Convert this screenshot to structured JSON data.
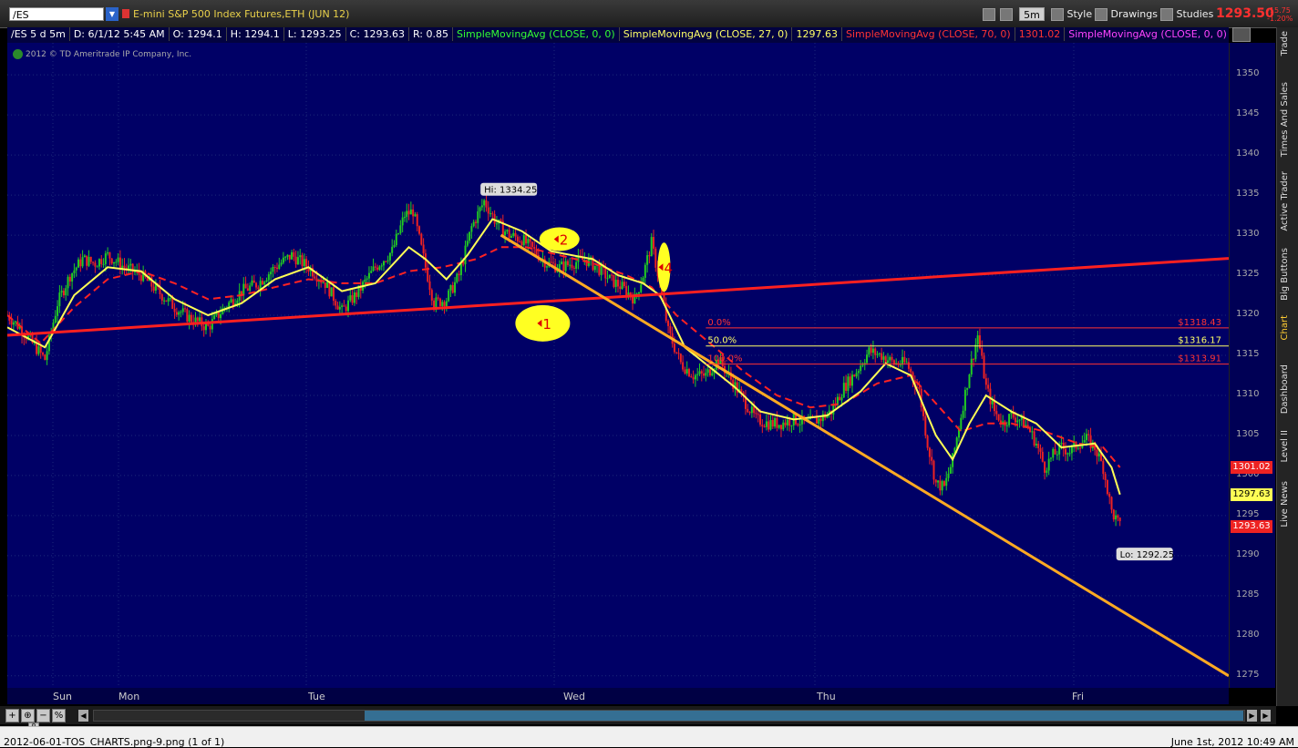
{
  "toolbar": {
    "symbol": "/ES",
    "instrument": "E-mini S&P 500 Index Futures,ETH (JUN 12)",
    "period": "5m",
    "style_label": "Style",
    "drawings_label": "Drawings",
    "studies_label": "Studies",
    "last_price": "1293.50",
    "change": "-15.75",
    "change_pct": "-1.20%"
  },
  "study_bar": {
    "items": [
      {
        "text": "/ES 5 d 5m",
        "color": "#ffffff"
      },
      {
        "text": "D: 6/1/12 5:45 AM",
        "color": "#ffffff"
      },
      {
        "text": "O: 1294.1",
        "color": "#ffffff"
      },
      {
        "text": "H: 1294.1",
        "color": "#ffffff"
      },
      {
        "text": "L: 1293.25",
        "color": "#ffffff"
      },
      {
        "text": "C: 1293.63",
        "color": "#ffffff"
      },
      {
        "text": "R: 0.85",
        "color": "#ffffff"
      },
      {
        "text": "SimpleMovingAvg (CLOSE, 0, 0)",
        "color": "#33ff33"
      },
      {
        "text": "SimpleMovingAvg (CLOSE, 27, 0)",
        "color": "#ffff66"
      },
      {
        "text": "1297.63",
        "color": "#ffff66"
      },
      {
        "text": "SimpleMovingAvg (CLOSE, 70, 0)",
        "color": "#ff3333"
      },
      {
        "text": "1301.02",
        "color": "#ff3333"
      },
      {
        "text": "SimpleMovingAvg (CLOSE, 0, 0)",
        "color": "#ff44ff"
      }
    ]
  },
  "credit": "2012 © TD Ameritrade IP Company, Inc.",
  "side_tabs": [
    "Trade",
    "Times And Sales",
    "Active Trader",
    "Big Buttons",
    "Chart",
    "Dashboard",
    "Level II",
    "Live News"
  ],
  "status": {
    "filename": "2012-06-01-TOS_CHARTS.png-9.png (1 of 1)",
    "datetime": "June 1st, 2012 10:49 AM"
  },
  "chart_data": {
    "type": "candlestick",
    "y_range": [
      1273.5,
      1354
    ],
    "y_ticks": [
      1350,
      1345,
      1340,
      1335,
      1330,
      1325,
      1320,
      1315,
      1310,
      1305,
      1300,
      1295,
      1290,
      1285,
      1280,
      1275
    ],
    "x_labels": [
      "Sun",
      "Mon",
      "Tue",
      "Wed",
      "Thu",
      "Fri"
    ],
    "colors": {
      "up": "#22cc22",
      "down": "#ee2222",
      "sma27": "#ffff55",
      "sma70": "#ff2222",
      "background": "#000066"
    },
    "price_path": [
      [
        0,
        1320
      ],
      [
        1.5,
        1318.5
      ],
      [
        3,
        1316.5
      ],
      [
        4.5,
        1314.5
      ],
      [
        6,
        1321.5
      ],
      [
        7.5,
        1325
      ],
      [
        9,
        1327
      ],
      [
        10.5,
        1326.5
      ],
      [
        12,
        1327.5
      ],
      [
        14,
        1326
      ],
      [
        16,
        1325
      ],
      [
        18,
        1323
      ],
      [
        20,
        1321
      ],
      [
        22,
        1319.5
      ],
      [
        24,
        1318.5
      ],
      [
        26,
        1321
      ],
      [
        28,
        1323
      ],
      [
        30,
        1324
      ],
      [
        32,
        1326
      ],
      [
        34,
        1327.5
      ],
      [
        36,
        1326
      ],
      [
        38,
        1324
      ],
      [
        40,
        1320.5
      ],
      [
        42,
        1323
      ],
      [
        44,
        1326
      ],
      [
        46,
        1328
      ],
      [
        47.5,
        1332.5
      ],
      [
        48.5,
        1333
      ],
      [
        50,
        1326
      ],
      [
        51,
        1321.5
      ],
      [
        52.5,
        1322
      ],
      [
        54,
        1325
      ],
      [
        55.5,
        1331
      ],
      [
        57,
        1334.25
      ],
      [
        58.5,
        1331.5
      ],
      [
        60,
        1330
      ],
      [
        61.5,
        1329.5
      ],
      [
        63,
        1328
      ],
      [
        64.5,
        1326.5
      ],
      [
        66,
        1326
      ],
      [
        67.5,
        1326.5
      ],
      [
        69,
        1327
      ],
      [
        70.5,
        1326
      ],
      [
        72,
        1324.5
      ],
      [
        73.5,
        1323.5
      ],
      [
        75,
        1322
      ],
      [
        76,
        1325
      ],
      [
        77,
        1329
      ],
      [
        78,
        1324
      ],
      [
        79,
        1318
      ],
      [
        80.5,
        1314
      ],
      [
        82,
        1312.5
      ],
      [
        83.5,
        1312.5
      ],
      [
        85,
        1314.5
      ],
      [
        86.5,
        1312
      ],
      [
        88,
        1309.5
      ],
      [
        89.5,
        1307
      ],
      [
        91,
        1306.5
      ],
      [
        92.5,
        1306.5
      ],
      [
        94,
        1307
      ],
      [
        95.5,
        1306.5
      ],
      [
        97,
        1307
      ],
      [
        98.5,
        1308
      ],
      [
        100,
        1311
      ],
      [
        101.5,
        1313
      ],
      [
        103,
        1315.5
      ],
      [
        104.5,
        1315
      ],
      [
        106,
        1314
      ],
      [
        107.5,
        1314
      ],
      [
        109,
        1310.5
      ],
      [
        110,
        1304
      ],
      [
        111,
        1299
      ],
      [
        112,
        1298.5
      ],
      [
        113,
        1302
      ],
      [
        114,
        1307.5
      ],
      [
        115,
        1313
      ],
      [
        116,
        1317.5
      ],
      [
        117,
        1311
      ],
      [
        118,
        1308
      ],
      [
        119,
        1306.5
      ],
      [
        120,
        1307.5
      ],
      [
        121,
        1307
      ],
      [
        122,
        1306
      ],
      [
        123,
        1304
      ],
      [
        124,
        1301
      ],
      [
        125,
        1302.5
      ],
      [
        126,
        1303.5
      ],
      [
        127,
        1303
      ],
      [
        128,
        1304
      ],
      [
        129,
        1304.5
      ],
      [
        130,
        1303.5
      ],
      [
        131,
        1301
      ],
      [
        132,
        1295.5
      ],
      [
        133,
        1293.63
      ]
    ],
    "sma27_path": [
      [
        0,
        1318.5
      ],
      [
        4.5,
        1316
      ],
      [
        8,
        1322.5
      ],
      [
        12,
        1326
      ],
      [
        16,
        1325.5
      ],
      [
        20,
        1322
      ],
      [
        24,
        1320
      ],
      [
        28,
        1321.5
      ],
      [
        32,
        1324.5
      ],
      [
        36,
        1326
      ],
      [
        40,
        1323
      ],
      [
        44,
        1324
      ],
      [
        48,
        1328.5
      ],
      [
        50,
        1327
      ],
      [
        52.5,
        1324.5
      ],
      [
        55,
        1327.5
      ],
      [
        58,
        1332
      ],
      [
        61.5,
        1330.5
      ],
      [
        65,
        1328
      ],
      [
        70,
        1327
      ],
      [
        73,
        1325
      ],
      [
        76,
        1324
      ],
      [
        78,
        1322.5
      ],
      [
        81,
        1316
      ],
      [
        84,
        1313.5
      ],
      [
        87,
        1311
      ],
      [
        90,
        1308
      ],
      [
        94,
        1307
      ],
      [
        98,
        1307.5
      ],
      [
        102,
        1310.5
      ],
      [
        105,
        1314
      ],
      [
        108,
        1312.5
      ],
      [
        111,
        1305
      ],
      [
        113,
        1302
      ],
      [
        115,
        1306.5
      ],
      [
        117,
        1310
      ],
      [
        120,
        1308
      ],
      [
        123,
        1306.5
      ],
      [
        126,
        1303.5
      ],
      [
        130,
        1304
      ],
      [
        132,
        1301
      ],
      [
        133,
        1297.63
      ]
    ],
    "sma70_path": [
      [
        0,
        1320
      ],
      [
        4,
        1316.5
      ],
      [
        8,
        1321
      ],
      [
        12,
        1324.5
      ],
      [
        16,
        1325.5
      ],
      [
        20,
        1324
      ],
      [
        24,
        1322
      ],
      [
        28,
        1322.5
      ],
      [
        32,
        1323.5
      ],
      [
        36,
        1324.5
      ],
      [
        40,
        1324
      ],
      [
        44,
        1324
      ],
      [
        48,
        1325.5
      ],
      [
        52,
        1326
      ],
      [
        56,
        1327
      ],
      [
        59,
        1328.5
      ],
      [
        62,
        1328.5
      ],
      [
        66,
        1327.5
      ],
      [
        70,
        1326.5
      ],
      [
        74,
        1325
      ],
      [
        77,
        1323.5
      ],
      [
        80,
        1320
      ],
      [
        84,
        1316.5
      ],
      [
        88,
        1313
      ],
      [
        92,
        1310
      ],
      [
        96,
        1308.5
      ],
      [
        100,
        1309
      ],
      [
        104,
        1311.5
      ],
      [
        108,
        1312.5
      ],
      [
        111,
        1309
      ],
      [
        114,
        1305.5
      ],
      [
        117,
        1306.5
      ],
      [
        120,
        1306.5
      ],
      [
        124,
        1305.5
      ],
      [
        128,
        1304
      ],
      [
        131,
        1303.5
      ],
      [
        133,
        1301.02
      ]
    ],
    "annotations": {
      "hi": {
        "text": "Hi: 1334.25",
        "x": 57,
        "y": 1334.25
      },
      "lo": {
        "text": "Lo: 1292.25",
        "x": 133,
        "y": 1292.25
      },
      "fib_levels": [
        {
          "pct": "0.0%",
          "price": 1318.43,
          "label": "$1318.43",
          "color": "#ff3333"
        },
        {
          "pct": "50.0%",
          "price": 1316.17,
          "label": "$1316.17",
          "color": "#ffff66"
        },
        {
          "pct": "100.0%",
          "price": 1313.91,
          "label": "$1313.91",
          "color": "#ff3333"
        }
      ],
      "trendlines": [
        {
          "name": "support-trendline",
          "color": "#ff2020",
          "from": [
            0,
            1317.5
          ],
          "to": [
            146,
            1327.1
          ]
        },
        {
          "name": "resistance-trendline",
          "color": "#ffaa22",
          "from": [
            59,
            1330
          ],
          "to": [
            146,
            1275
          ]
        }
      ],
      "markers": [
        {
          "label": "1",
          "x": 64,
          "y": 1319
        },
        {
          "label": "2",
          "x": 66,
          "y": 1329.5
        },
        {
          "label": "4",
          "x": 78.5,
          "y": 1326
        }
      ]
    },
    "price_tags": [
      {
        "text": "1301.02",
        "y": 1301.02,
        "bg": "#ee2222",
        "fg": "#ffffff"
      },
      {
        "text": "1297.63",
        "y": 1297.63,
        "bg": "#ffff55",
        "fg": "#000000"
      },
      {
        "text": "1293.63",
        "y": 1293.63,
        "bg": "#ee2222",
        "fg": "#ffffff"
      }
    ]
  }
}
